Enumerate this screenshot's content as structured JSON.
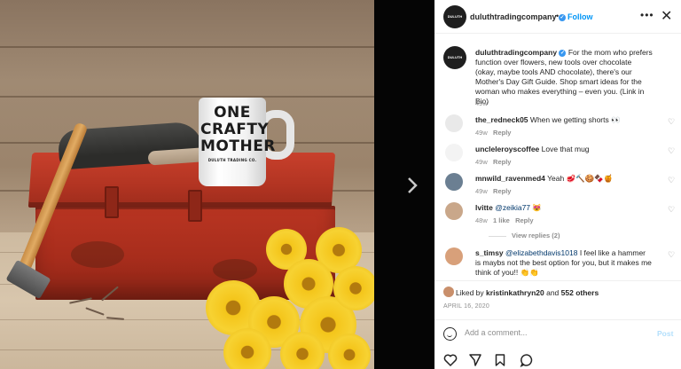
{
  "mug": {
    "line1": "ONE",
    "line2": "CRAFTY",
    "line3": "MOTHER",
    "brand": "DULUTH TRADING CO."
  },
  "header": {
    "avatar_text": "DULUTH TRADING",
    "username": "duluthtradingcompany",
    "dot": "•",
    "follow_label": "Follow",
    "more_label": "•••",
    "close_label": "✕"
  },
  "caption": {
    "username": "duluthtradingcompany",
    "text": "For the mom who prefers function over flowers, new tools over chocolate (okay, maybe tools AND chocolate), there's our Mother's Day Gift Guide. Shop smart ideas for the woman who makes everything – even you. (Link in Bio)",
    "age": "49w"
  },
  "comments": [
    {
      "username": "the_redneck05",
      "text": "When we getting shorts 👀",
      "age": "49w",
      "likes": "",
      "reply": "Reply"
    },
    {
      "username": "uncleleroyscoffee",
      "text": "Love that mug",
      "age": "49w",
      "likes": "",
      "reply": "Reply"
    },
    {
      "username": "mnwild_ravenmed4",
      "text": "Yeah 🥩🔨🍪🍫🍯",
      "age": "49w",
      "likes": "",
      "reply": "Reply"
    },
    {
      "username": "lvitte",
      "mention": "@zeikia77",
      "text": "😻",
      "age": "48w",
      "likes": "1 like",
      "reply": "Reply"
    },
    {
      "username": "s_timsy",
      "mention": "@elizabethdavis1018",
      "text": "I feel like a hammer is maybs not the best option for you, but it makes me think of you!! 👏👏",
      "age": "",
      "likes": "",
      "reply": ""
    }
  ],
  "view_replies": "View replies (2)",
  "likes": {
    "prefix": "Liked by",
    "user": "kristinkathryn20",
    "and": "and",
    "others": "552 others"
  },
  "date": "APRIL 16, 2020",
  "add_comment": {
    "placeholder": "Add a comment...",
    "post_label": "Post"
  },
  "colors": {
    "accent": "#0095f6",
    "toolbox_red": "#b23422",
    "flower_yellow": "#f4c51a"
  }
}
